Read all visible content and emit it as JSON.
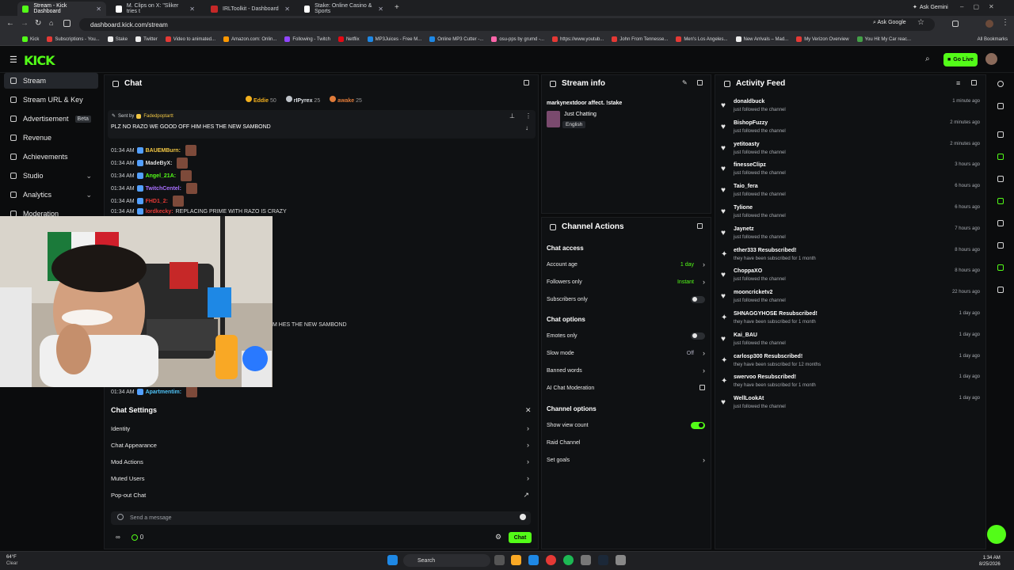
{
  "browser": {
    "tabs": [
      {
        "title": "Stream - Kick Dashboard",
        "active": true,
        "color": "#53fc18"
      },
      {
        "title": "M. Clips on X: \"Sliker tries t",
        "active": false,
        "color": "#ffffff"
      },
      {
        "title": "IRLToolkit - Dashboard",
        "active": false,
        "color": "#c62828"
      },
      {
        "title": "Stake: Online Casino & Sports",
        "active": false,
        "color": "#ffffff"
      }
    ],
    "ask_gemini": "Ask Gemini",
    "url": "dashboard.kick.com/stream",
    "ask_google": "Ask Google",
    "bookmarks": [
      {
        "label": "Kick",
        "color": "#53fc18"
      },
      {
        "label": "Subscriptions - You...",
        "color": "#e53935"
      },
      {
        "label": "Stake",
        "color": "#eeeeee"
      },
      {
        "label": "Twitter",
        "color": "#eeeeee"
      },
      {
        "label": "Video to animated...",
        "color": "#e53935"
      },
      {
        "label": "Amazon.com: Onlin...",
        "color": "#ff9800"
      },
      {
        "label": "Following - Twitch",
        "color": "#9146ff"
      },
      {
        "label": "Netflix",
        "color": "#e50914"
      },
      {
        "label": "MP3Juices - Free M...",
        "color": "#1e88e5"
      },
      {
        "label": "Online MP3 Cutter -...",
        "color": "#1e88e5"
      },
      {
        "label": "osu-pps by grumd -...",
        "color": "#ff66aa"
      },
      {
        "label": "https://www.youtub...",
        "color": "#e53935"
      },
      {
        "label": "John From Tennesse...",
        "color": "#e53935"
      },
      {
        "label": "Men's Los Angeles...",
        "color": "#e53935"
      },
      {
        "label": "New Arrivals – Mad...",
        "color": "#eeeeee"
      },
      {
        "label": "My Verizon Overview",
        "color": "#e53935"
      },
      {
        "label": "You Hit My Car reac...",
        "color": "#43a047"
      }
    ],
    "all_bookmarks": "All Bookmarks"
  },
  "kick": {
    "logo": "KICK",
    "go_live": "Go Live"
  },
  "nav": {
    "items": [
      {
        "label": "Stream",
        "active": true
      },
      {
        "label": "Stream URL & Key"
      },
      {
        "label": "Advertisement",
        "badge": "Beta"
      },
      {
        "label": "Revenue"
      },
      {
        "label": "Achievements"
      },
      {
        "label": "Studio",
        "chevron": true
      },
      {
        "label": "Analytics",
        "chevron": true
      },
      {
        "label": "Moderation"
      }
    ]
  },
  "chat": {
    "title": "Chat",
    "top_gifters": [
      {
        "name": "Eddie",
        "count": "50",
        "color": "#f2b01e"
      },
      {
        "name": "rIPyrex",
        "count": "25",
        "color": "#bfc4ca"
      },
      {
        "name": "awake",
        "count": "25",
        "color": "#e07b39"
      }
    ],
    "pinned": {
      "sent_by_label": "Sent by",
      "sender": "Fadedpoptartt",
      "message": "PLZ NO RAZO WE GOOD OFF HIM HES THE NEW SAMBOND"
    },
    "messages": [
      {
        "time": "01:34 AM",
        "user": "BAUEMBurn:",
        "color": "#f2c744",
        "text": ""
      },
      {
        "time": "01:34 AM",
        "user": "MadeByX:",
        "color": "#dcdcdc",
        "text": ""
      },
      {
        "time": "01:34 AM",
        "user": "Angel_21A:",
        "color": "#53fc18",
        "text": ""
      },
      {
        "time": "01:34 AM",
        "user": "TwitchCentel:",
        "color": "#a970ff",
        "text": ""
      },
      {
        "time": "01:34 AM",
        "user": "FHD1_2:",
        "color": "#e53935",
        "text": ""
      },
      {
        "time": "01:34 AM",
        "user": "lordkecky:",
        "color": "#e53935",
        "text": "REPLACING PRIME WITH RAZO IS CRAZY"
      },
      {
        "time": "",
        "user": "",
        "color": "#dcdcdc",
        "text": "M HES THE NEW SAMBOND"
      },
      {
        "time": "01:34 AM",
        "user": "Apartmentim:",
        "color": "#4fc3f7",
        "text": ""
      }
    ],
    "settings": {
      "title": "Chat Settings",
      "items": [
        "Identity",
        "Chat Appearance",
        "Mod Actions",
        "Muted Users",
        "Pop-out Chat"
      ]
    },
    "input_placeholder": "Send a message",
    "points": "0",
    "send_label": "Chat"
  },
  "stream_info": {
    "title": "Stream info",
    "stream_title": "markynextdoor affect. !stake",
    "category": "Just Chatting",
    "language": "English"
  },
  "channel_actions": {
    "title": "Channel Actions",
    "chat_access": "Chat access",
    "account_age_label": "Account age",
    "account_age_value": "1 day",
    "followers_only_label": "Followers only",
    "followers_only_value": "Instant",
    "subscribers_only_label": "Subscribers only",
    "chat_options": "Chat options",
    "emotes_only_label": "Emotes only",
    "slow_mode_label": "Slow mode",
    "slow_mode_value": "Off",
    "banned_words_label": "Banned words",
    "ai_moderation_label": "AI Chat Moderation",
    "channel_options": "Channel options",
    "show_view_count_label": "Show view count",
    "raid_channel_label": "Raid Channel",
    "set_goals_label": "Set goals"
  },
  "activity": {
    "title": "Activity Feed",
    "items": [
      {
        "name": "donaldbuck",
        "sub": "just followed the channel",
        "time": "1 minute ago",
        "type": "follow"
      },
      {
        "name": "BishopFuzzy",
        "sub": "just followed the channel",
        "time": "2 minutes ago",
        "type": "follow"
      },
      {
        "name": "yetitoasty",
        "sub": "just followed the channel",
        "time": "2 minutes ago",
        "type": "follow"
      },
      {
        "name": "finesseClipz",
        "sub": "just followed the channel",
        "time": "3 hours ago",
        "type": "follow"
      },
      {
        "name": "Taio_fera",
        "sub": "just followed the channel",
        "time": "6 hours ago",
        "type": "follow"
      },
      {
        "name": "Tylione",
        "sub": "just followed the channel",
        "time": "6 hours ago",
        "type": "follow"
      },
      {
        "name": "Jaynetz",
        "sub": "just followed the channel",
        "time": "7 hours ago",
        "type": "follow"
      },
      {
        "name": "ether333 Resubscribed!",
        "sub": "they have been subscribed for 1 month",
        "time": "8 hours ago",
        "type": "sub"
      },
      {
        "name": "ChoppaXO",
        "sub": "just followed the channel",
        "time": "8 hours ago",
        "type": "follow"
      },
      {
        "name": "mooncricketv2",
        "sub": "just followed the channel",
        "time": "22 hours ago",
        "type": "follow"
      },
      {
        "name": "SHNAGGYHOSE Resubscribed!",
        "sub": "they have been subscribed for 1 month",
        "time": "1 day ago",
        "type": "sub"
      },
      {
        "name": "Kai_BAU",
        "sub": "just followed the channel",
        "time": "1 day ago",
        "type": "follow"
      },
      {
        "name": "carlosp300 Resubscribed!",
        "sub": "they have been subscribed for 12 months",
        "time": "1 day ago",
        "type": "sub"
      },
      {
        "name": "swervoo Resubscribed!",
        "sub": "they have been subscribed for 1 month",
        "time": "1 day ago",
        "type": "sub"
      },
      {
        "name": "WellLookAt",
        "sub": "just followed the channel",
        "time": "1 day ago",
        "type": "follow"
      }
    ]
  },
  "taskbar": {
    "weather_temp": "64°F",
    "weather_desc": "Clear",
    "search": "Search",
    "time": "1:34 AM",
    "date": "8/25/2026"
  }
}
